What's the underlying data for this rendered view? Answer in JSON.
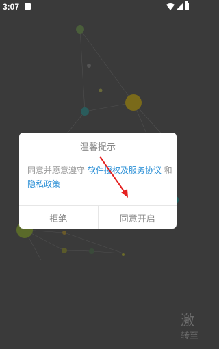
{
  "status_bar": {
    "time": "3:07",
    "icons": [
      "notification-icon",
      "wifi-icon",
      "signal-icon",
      "battery-icon"
    ]
  },
  "background": {
    "title_partial": "激",
    "subtitle_partial": "转至"
  },
  "dialog": {
    "title": "温馨提示",
    "body_prefix": "同意并愿意遵守 ",
    "link_terms": "软件授权及服务协议",
    "body_mid": " 和 ",
    "link_privacy": "隐私政策",
    "reject_label": "拒绝",
    "accept_label": "同意开启"
  },
  "colors": {
    "overlay": "#3a3a3a",
    "link": "#2a8fd6",
    "annotation": "#e52020"
  }
}
